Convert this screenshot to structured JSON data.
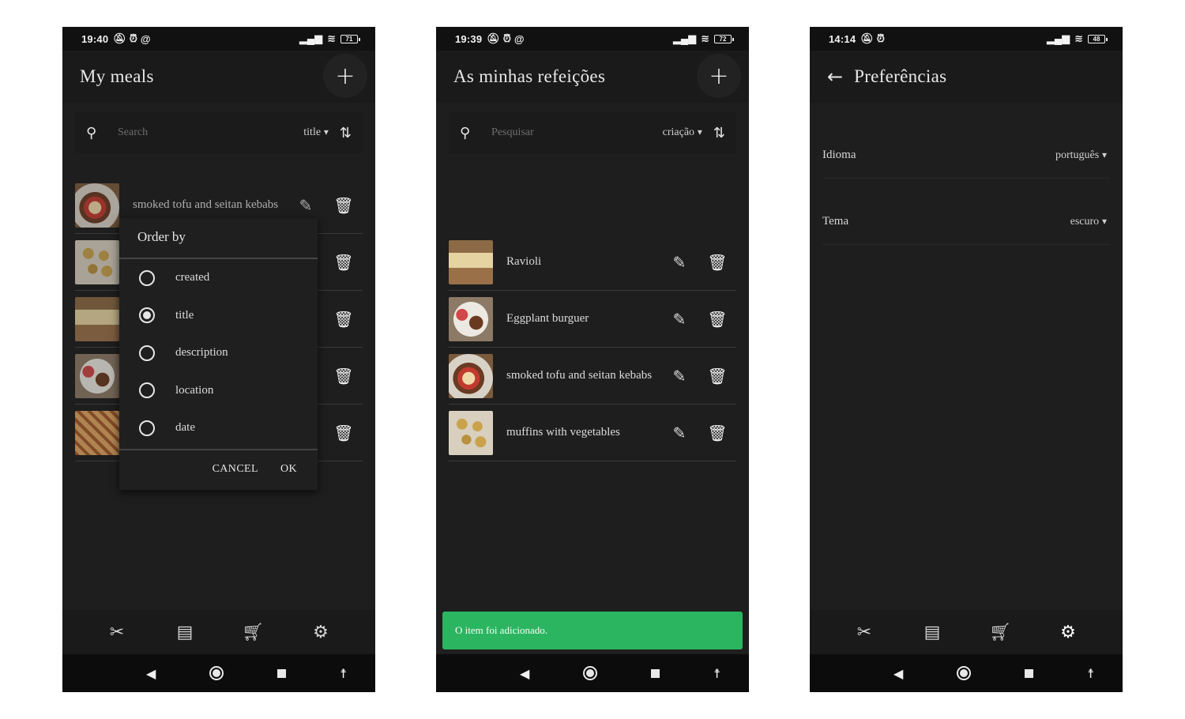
{
  "screens": [
    {
      "status": {
        "time": "19:40",
        "battery": "71"
      },
      "appbar": {
        "title": "My meals",
        "add_icon": "+"
      },
      "search": {
        "placeholder": "Search",
        "order_value": "title"
      },
      "meals": [
        "smoked tofu and seitan kebabs"
      ],
      "order_dialog": {
        "title": "Order by",
        "options": [
          "created",
          "title",
          "description",
          "location",
          "date"
        ],
        "selected": "title",
        "cancel": "CANCEL",
        "ok": "OK"
      }
    },
    {
      "status": {
        "time": "19:39",
        "battery": "72"
      },
      "appbar": {
        "title": "As minhas refeições",
        "add_icon": "+"
      },
      "search": {
        "placeholder": "Pesquisar",
        "order_value": "criação"
      },
      "meals": [
        "Ravioli",
        "Eggplant burguer",
        "smoked tofu and seitan kebabs",
        "muffins with vegetables"
      ],
      "snackbar": "O item foi adicionado.",
      "snackbar_color": "#2bb561"
    },
    {
      "status": {
        "time": "14:14",
        "battery": "48"
      },
      "appbar": {
        "title": "Preferências",
        "back_icon": "←"
      },
      "preferences": [
        {
          "label": "Idioma",
          "value": "português"
        },
        {
          "label": "Tema",
          "value": "escuro"
        }
      ]
    }
  ],
  "bottom_nav": [
    "meals-icon",
    "recipes-icon",
    "shopping-cart-icon",
    "settings-icon"
  ],
  "system_nav": [
    "back-triangle-icon",
    "home-circle-icon",
    "recents-square-icon",
    "accessibility-icon"
  ]
}
